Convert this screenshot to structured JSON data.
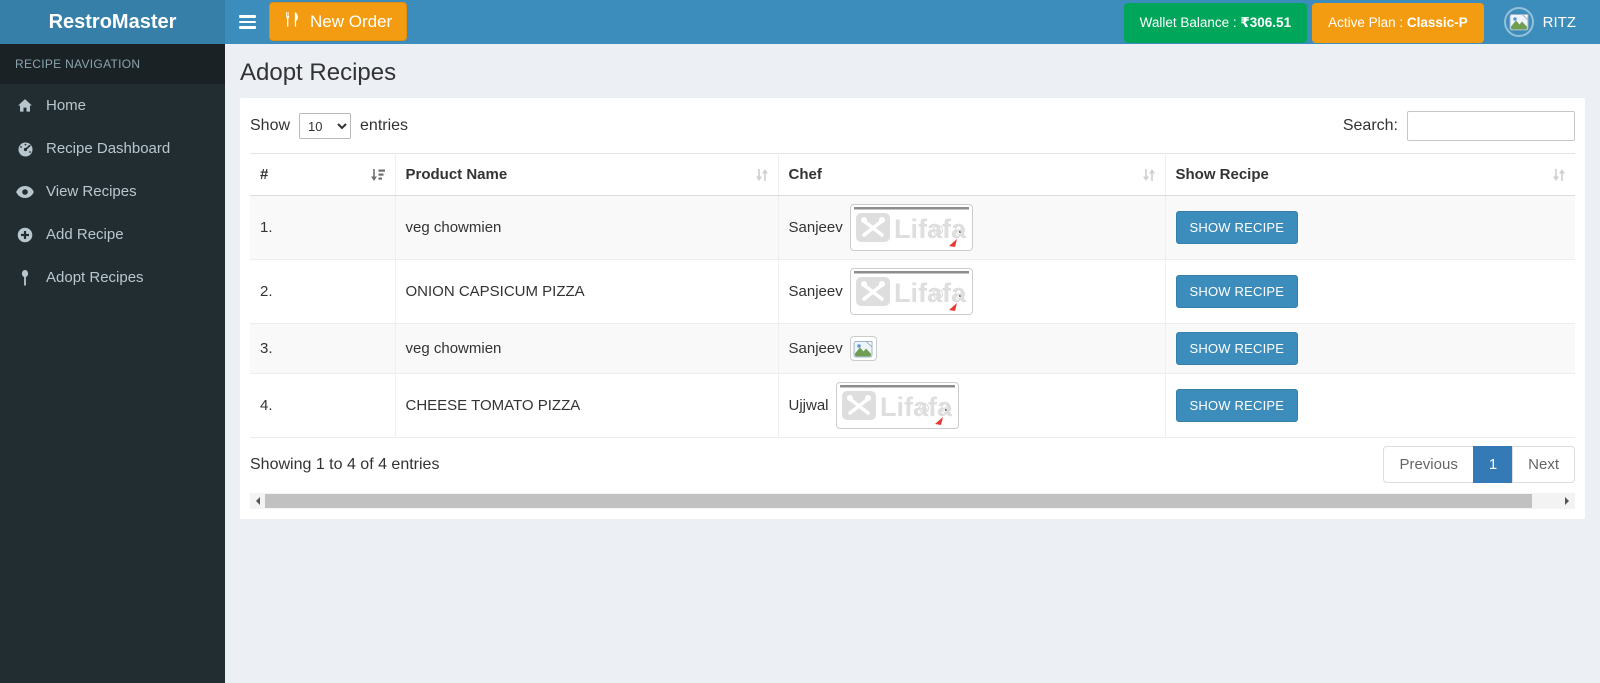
{
  "colors": {
    "navbar_blue": "#3c8dbc",
    "brand_bg_blue": "#367fa9",
    "sidebar_dark": "#222d32",
    "wallet_green": "#00a65a",
    "plan_orange": "#f39c12",
    "button_blue": "#3c8dbc",
    "active_page_blue": "#337ab7",
    "page_background": "#ecf0f5"
  },
  "navbar": {
    "brand": "RestroMaster",
    "new_order_label": "New Order",
    "wallet_label": "Wallet Balance : ",
    "wallet_value": "₹306.51",
    "plan_label": "Active Plan : ",
    "plan_value": "Classic-P",
    "username": "RITZ"
  },
  "sidebar": {
    "header": "RECIPE NAVIGATION",
    "items": [
      {
        "label": "Home",
        "icon": "home-icon"
      },
      {
        "label": "Recipe Dashboard",
        "icon": "dashboard-icon"
      },
      {
        "label": "View Recipes",
        "icon": "eye-icon"
      },
      {
        "label": "Add Recipe",
        "icon": "plus-circle-icon"
      },
      {
        "label": "Adopt Recipes",
        "icon": "spoon-icon"
      }
    ]
  },
  "page": {
    "title": "Adopt Recipes"
  },
  "controls": {
    "show_label": "Show",
    "page_length": "10",
    "entries_label": "entries",
    "search_label": "Search:",
    "search_value": ""
  },
  "table": {
    "columns": [
      "#",
      "Product Name",
      "Chef",
      "Show Recipe"
    ],
    "rows": [
      {
        "num": "1.",
        "product": "veg chowmien",
        "chef": "Sanjeev",
        "image": "lifafa-watermark",
        "action": "SHOW RECIPE"
      },
      {
        "num": "2.",
        "product": "ONION CAPSICUM PIZZA",
        "chef": "Sanjeev",
        "image": "lifafa-watermark",
        "action": "SHOW RECIPE"
      },
      {
        "num": "3.",
        "product": "veg chowmien",
        "chef": "Sanjeev",
        "image": "broken-image",
        "action": "SHOW RECIPE"
      },
      {
        "num": "4.",
        "product": "CHEESE TOMATO PIZZA",
        "chef": "Ujjwal",
        "image": "lifafa-watermark",
        "action": "SHOW RECIPE"
      }
    ]
  },
  "watermark_text": "Lifafa",
  "footer": {
    "info": "Showing 1 to 4 of 4 entries",
    "previous_label": "Previous",
    "current_page": "1",
    "next_label": "Next"
  }
}
